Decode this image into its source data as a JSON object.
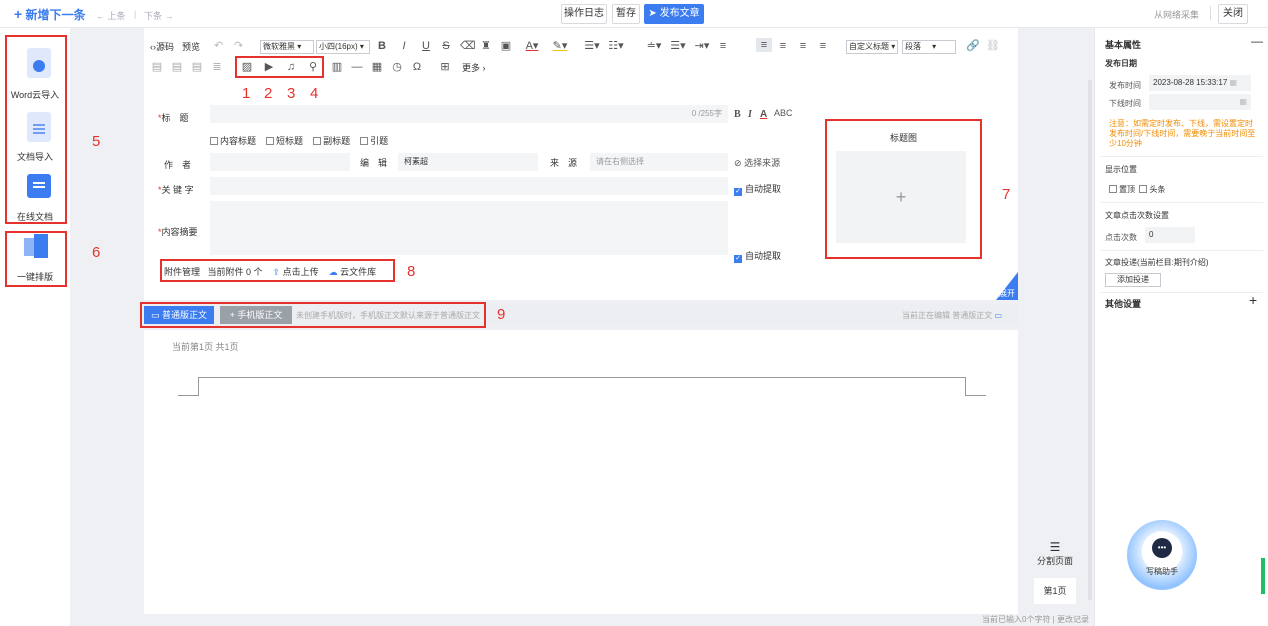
{
  "top": {
    "new_label": "新增下一条",
    "prev": "← 上条",
    "sep": "|",
    "next": "下条 →",
    "log": "操作日志",
    "save": "暂存",
    "publish": "发布文章",
    "collect": "从网络采集",
    "close": "关闭"
  },
  "left": {
    "word": "Word云导入",
    "doc": "文档导入",
    "online": "在线文档",
    "layout": "一键排版"
  },
  "annotations": [
    "1",
    "2",
    "3",
    "4",
    "5",
    "6",
    "7",
    "8",
    "9"
  ],
  "toolbar": {
    "source": "源码",
    "preview": "预览",
    "font": "微软雅黑",
    "size": "小四(16px)",
    "custom_title": "自定义标题",
    "para": "段落",
    "more": "更多"
  },
  "form": {
    "title_label": "标　题",
    "title_count": "0 /255字",
    "opt1": "内容标题",
    "opt2": "短标题",
    "opt3": "副标题",
    "opt4": "引题",
    "author_label": "作　者",
    "editor_label": "编　辑",
    "editor_value": "柯素超",
    "source_label": "来　源",
    "source_placeholder": "请在右侧选择",
    "choose_source": "选择来源",
    "keyword_label": "关 键 字",
    "auto": "自动提取",
    "summary_label": "内容摘要",
    "attach_label": "附件管理",
    "attach_count": "当前附件 0 个",
    "upload": "点击上传",
    "cloud": "云文件库",
    "cover_label": "标题图",
    "expand": "展开"
  },
  "tabs": {
    "normal": "普通版正文",
    "mobile": "+ 手机版正文",
    "hint": "未创建手机版时，手机版正文默认来源于普通版正文",
    "editing": "当前正在编辑  普通版正文"
  },
  "page": {
    "info": "当前第1页  共1页",
    "split": "分割页面",
    "page1": "第1页",
    "footer": "当前已输入0个字符 | 更改记录"
  },
  "right": {
    "basic": "基本属性",
    "pub_date": "发布日期",
    "pub_time_label": "发布时间",
    "pub_time_value": "2023-08-28 15:33:17",
    "off_time_label": "下线时间",
    "note": "注意：如需定时发布、下线，需设置定时发布时间/下线时间，需要晚于当前时间至少10分钟",
    "display": "显示位置",
    "top_opt": "置顶",
    "headline": "头条",
    "click_set": "文章点击次数设置",
    "click_label": "点击次数",
    "click_value": "0",
    "deliver": "文章投递(当前栏目:期刊介绍)",
    "add_deliver": "添加投递",
    "other": "其他设置",
    "assistant": "写稿助手"
  },
  "colors": {
    "accent": "#3b7df0",
    "annotation": "#e5322d",
    "note": "#f08c00"
  }
}
